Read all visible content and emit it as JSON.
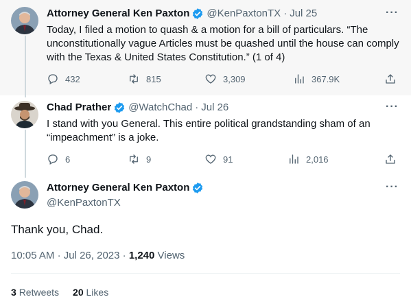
{
  "tweets": [
    {
      "name": "Attorney General Ken Paxton",
      "handle": "@KenPaxtonTX",
      "date": "Jul 25",
      "text": "Today, I filed a motion to quash & a motion for a bill of particulars. “The unconstitutionally vague Articles must be quashed until the house can comply with the Texas & United States Constitution.” (1 of 4)",
      "replies": "432",
      "retweets": "815",
      "likes": "3,309",
      "views": "367.9K"
    },
    {
      "name": "Chad Prather",
      "handle": "@WatchChad",
      "date": "Jul 26",
      "text": "I stand with you General. This entire political grandstanding sham of an “impeachment” is a joke.",
      "replies": "6",
      "retweets": "9",
      "likes": "91",
      "views": "2,016"
    }
  ],
  "main": {
    "name": "Attorney General Ken Paxton",
    "handle": "@KenPaxtonTX",
    "text": "Thank you, Chad.",
    "time": "10:05 AM",
    "date": "Jul 26, 2023",
    "views_count": "1,240",
    "views_label": "Views",
    "retweets_count": "3",
    "retweets_label": "Retweets",
    "likes_count": "20",
    "likes_label": "Likes"
  },
  "icons": {
    "reply": "reply-icon",
    "retweet": "retweet-icon",
    "like": "heart-icon",
    "views": "views-icon",
    "share": "share-icon",
    "verified": "verified-badge-icon",
    "more": "more-icon"
  },
  "colors": {
    "verified": "#1d9bf0",
    "secondary_text": "#536471",
    "thread_line": "#cfd9de",
    "highlight_bg": "#f7f7f7"
  }
}
